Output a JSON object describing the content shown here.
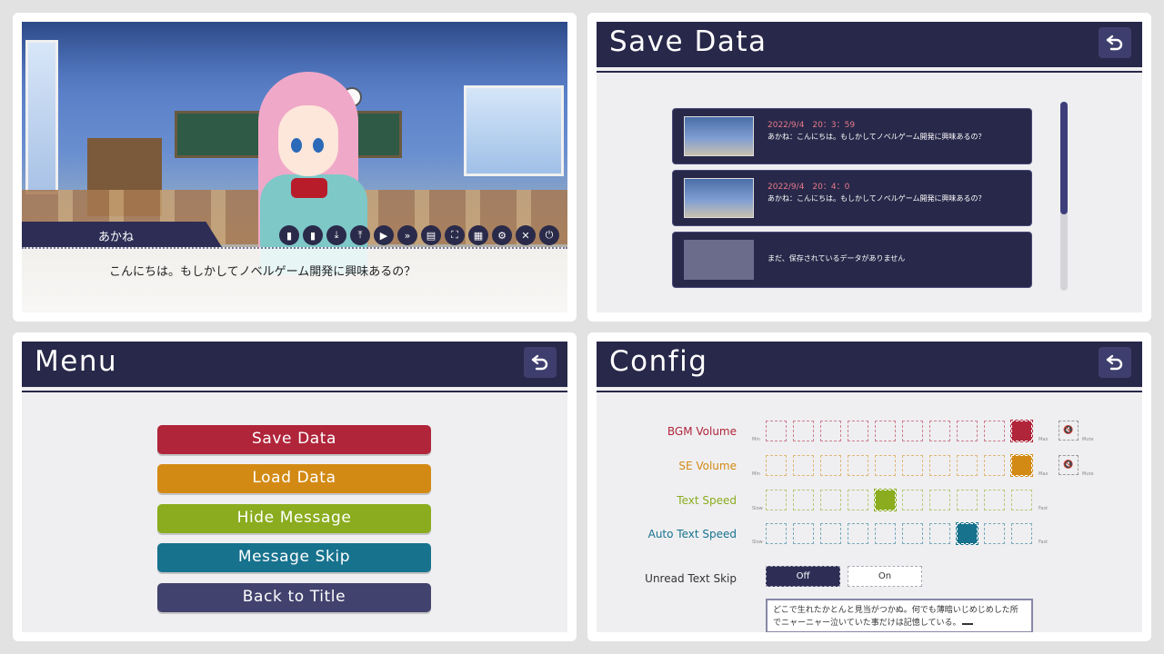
{
  "game_screen": {
    "character_name": "あかね",
    "message": "こんにちは。もしかしてノベルゲーム開発に興味あるの？",
    "toolbar_icons": [
      "bookmark-icon",
      "bookmark-alt-icon",
      "download-icon",
      "upload-icon",
      "play-icon",
      "fast-forward-icon",
      "document-icon",
      "fullscreen-icon",
      "grid-icon",
      "gear-icon",
      "close-icon",
      "power-icon"
    ]
  },
  "save_screen": {
    "title": "Save Data",
    "slots": [
      {
        "date": "2022/9/4　20：3：59",
        "text": "あかね：こんにちは。もしかしてノベルゲーム開発に興味あるの？",
        "has_thumb": true
      },
      {
        "date": "2022/9/4　20：4：0",
        "text": "あかね：こんにちは。もしかしてノベルゲーム開発に興味あるの？",
        "has_thumb": true
      },
      {
        "date": "",
        "text": "まだ、保存されているデータがありません",
        "has_thumb": false
      }
    ]
  },
  "menu_screen": {
    "title": "Menu",
    "buttons": [
      {
        "label": "Save Data",
        "color": "#b0253a"
      },
      {
        "label": "Load Data",
        "color": "#d38a14"
      },
      {
        "label": "Hide Message",
        "color": "#8aac1e"
      },
      {
        "label": "Message Skip",
        "color": "#17728e"
      },
      {
        "label": "Back to Title",
        "color": "#42426e"
      }
    ]
  },
  "config_screen": {
    "title": "Config",
    "rows": [
      {
        "label": "BGM Volume",
        "color": "#b0253a",
        "min": "Min",
        "max": "Max",
        "level": 10,
        "mute": "Mute"
      },
      {
        "label": "SE Volume",
        "color": "#d38a14",
        "min": "Min",
        "max": "Max",
        "level": 10,
        "mute": "Mute"
      },
      {
        "label": "Text Speed",
        "color": "#8aac1e",
        "min": "Slow",
        "max": "Fast",
        "level": 5
      },
      {
        "label": "Auto Text Speed",
        "color": "#17728e",
        "min": "Slow",
        "max": "Fast",
        "level": 8
      }
    ],
    "unread_skip": {
      "label": "Unread Text Skip",
      "off": "Off",
      "on": "On",
      "selected": "Off"
    },
    "preview_text": "どこで生れたかとんと見当がつかぬ。何でも薄暗いじめじめした所でニャーニャー泣いていた事だけは記憶している。"
  }
}
